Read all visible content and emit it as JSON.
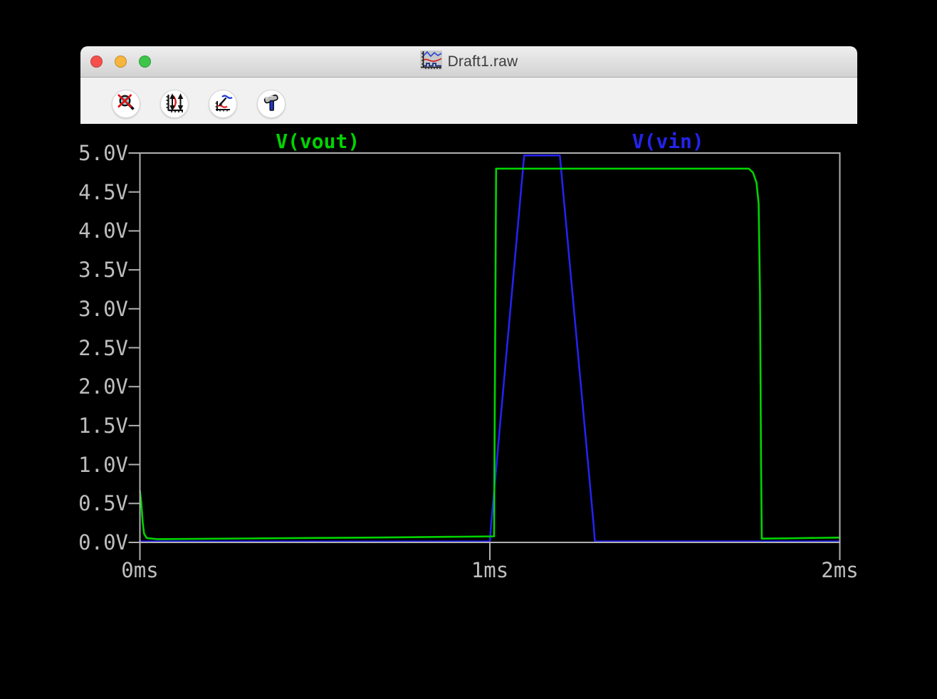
{
  "window": {
    "title": "Draft1.raw",
    "titlebar_icon": "waveform-plot-icon",
    "traffic_lights": {
      "close": "#f5504c",
      "minimize": "#f6b53c",
      "zoom": "#3dc649"
    }
  },
  "toolbar": {
    "buttons": [
      {
        "name": "zoom-back",
        "icon": "magnifier-crossed-icon"
      },
      {
        "name": "autorange-y-axis",
        "icon": "y-axis-range-icon"
      },
      {
        "name": "zoom-to-fit",
        "icon": "pan-plot-icon"
      },
      {
        "name": "control-panel",
        "icon": "hammer-icon"
      }
    ]
  },
  "chart_data": {
    "type": "line",
    "title": "",
    "xlabel": "",
    "ylabel": "",
    "x_unit": "ms",
    "y_unit": "V",
    "xlim": [
      0,
      2
    ],
    "ylim": [
      0,
      5
    ],
    "grid": false,
    "legend_position": "top",
    "bg_color": "#000000",
    "axis_color": "#b0b0b0",
    "tick_label_color": "#bdbdbd",
    "xticks": {
      "values": [
        0,
        1,
        2
      ],
      "labels": [
        "0ms",
        "1ms",
        "2ms"
      ]
    },
    "yticks": {
      "values": [
        5.0,
        4.5,
        4.0,
        3.5,
        3.0,
        2.5,
        2.0,
        1.5,
        1.0,
        0.5,
        0.0
      ],
      "labels": [
        "5.0V",
        "4.5V",
        "4.0V",
        "3.5V",
        "3.0V",
        "2.5V",
        "2.0V",
        "1.5V",
        "1.0V",
        "0.5V",
        "0.0V"
      ]
    },
    "series": [
      {
        "name": "V(vout)",
        "color": "#00d400",
        "points": [
          [
            0,
            0.66
          ],
          [
            0.004,
            0.5
          ],
          [
            0.008,
            0.26
          ],
          [
            0.012,
            0.11
          ],
          [
            0.02,
            0.055
          ],
          [
            0.05,
            0.042
          ],
          [
            0.3,
            0.05
          ],
          [
            0.7,
            0.063
          ],
          [
            1.012,
            0.078
          ],
          [
            1.015,
            2.5
          ],
          [
            1.018,
            4.8
          ],
          [
            1.2,
            4.8
          ],
          [
            1.5,
            4.8
          ],
          [
            1.74,
            4.8
          ],
          [
            1.752,
            4.75
          ],
          [
            1.762,
            4.62
          ],
          [
            1.768,
            4.35
          ],
          [
            1.772,
            3.2
          ],
          [
            1.775,
            1.0
          ],
          [
            1.777,
            0.048
          ],
          [
            1.85,
            0.052
          ],
          [
            2.0,
            0.062
          ]
        ]
      },
      {
        "name": "V(vin)",
        "color": "#2323ee",
        "points": [
          [
            0,
            0.012
          ],
          [
            1.0,
            0.012
          ],
          [
            1.004,
            0.25
          ],
          [
            1.098,
            4.97
          ],
          [
            1.2,
            4.97
          ],
          [
            1.296,
            0.25
          ],
          [
            1.3,
            0.012
          ],
          [
            2.0,
            0.012
          ]
        ]
      }
    ]
  }
}
